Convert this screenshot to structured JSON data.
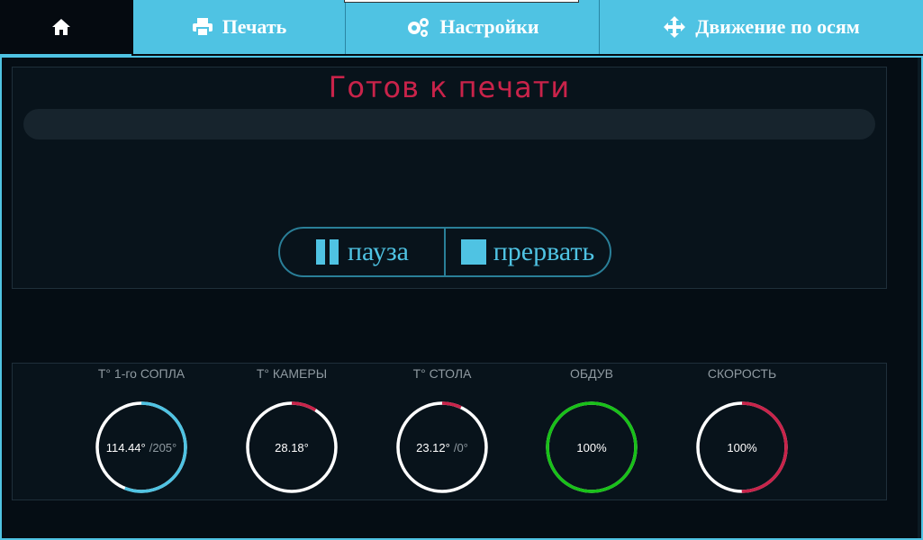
{
  "tabs": [
    {
      "label": "",
      "icon": "home-icon",
      "active": true
    },
    {
      "label": "Печать",
      "icon": "print-icon"
    },
    {
      "label": "Настройки",
      "icon": "gears-icon"
    },
    {
      "label": "Движение по осям",
      "icon": "move-arrows-icon"
    }
  ],
  "status": {
    "title": "Готов к печати",
    "progress": 0
  },
  "controls": {
    "pause_label": "пауза",
    "abort_label": "прервать"
  },
  "gauges": [
    {
      "label": "T° 1-го СОПЛА",
      "value": "114.44°",
      "target": "/205°",
      "fraction": 0.56,
      "color": "#4fc3e3"
    },
    {
      "label": "T° КАМЕРЫ",
      "value": "28.18°",
      "target": "",
      "fraction": 0.09,
      "color": "#c9234a"
    },
    {
      "label": "T° СТОЛА",
      "value": "23.12°",
      "target": "/0°",
      "fraction": 0.07,
      "color": "#c9234a"
    },
    {
      "label": "ОБДУВ",
      "value": "100%",
      "target": "",
      "fraction": 1.0,
      "color": "#18c118"
    },
    {
      "label": "СКОРОСТЬ",
      "value": "100%",
      "target": "",
      "fraction": 0.5,
      "color": "#c9234a"
    }
  ],
  "colors": {
    "accent": "#4fc3e3",
    "status": "#c9234a",
    "fan": "#18c118"
  }
}
